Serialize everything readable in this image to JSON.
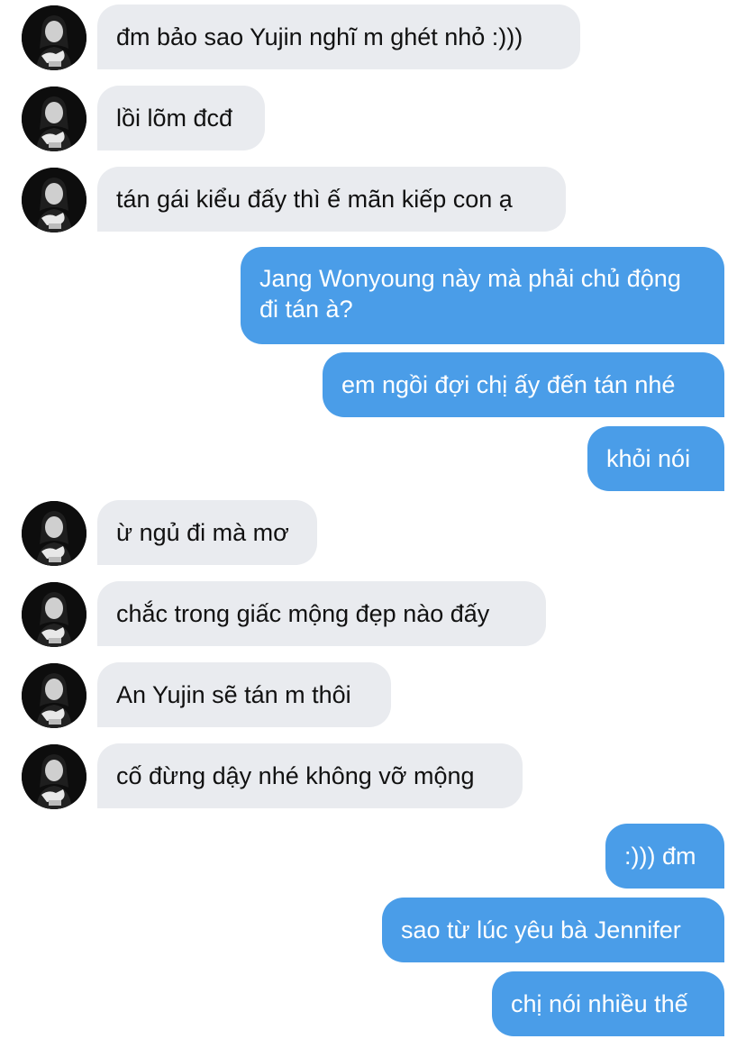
{
  "conversation": {
    "avatar_icon": "profile-photo-icon",
    "colors": {
      "incoming_bubble": "#e9ebef",
      "outgoing_bubble": "#4a9de8",
      "incoming_text": "#111111",
      "outgoing_text": "#ffffff"
    },
    "messages": [
      {
        "sender": "other",
        "text": "đm bảo sao Yujin nghĩ m ghét nhỏ :)))"
      },
      {
        "sender": "other",
        "text": "lồi lõm đcđ"
      },
      {
        "sender": "other",
        "text": "tán gái kiểu đấy thì ế mãn kiếp con ạ"
      },
      {
        "sender": "me",
        "text": "Jang Wonyoung này mà phải chủ động đi tán à?"
      },
      {
        "sender": "me",
        "text": "em ngồi đợi chị ấy đến tán nhé"
      },
      {
        "sender": "me",
        "text": "khỏi nói"
      },
      {
        "sender": "other",
        "text": "ừ ngủ đi mà mơ"
      },
      {
        "sender": "other",
        "text": "chắc trong giấc mộng đẹp nào đấy"
      },
      {
        "sender": "other",
        "text": "An Yujin sẽ tán m thôi"
      },
      {
        "sender": "other",
        "text": "cố đừng dậy nhé không vỡ mộng"
      },
      {
        "sender": "me",
        "text": ":))) đm"
      },
      {
        "sender": "me",
        "text": "sao từ lúc yêu bà Jennifer"
      },
      {
        "sender": "me",
        "text": "chị nói nhiều thế"
      }
    ]
  }
}
